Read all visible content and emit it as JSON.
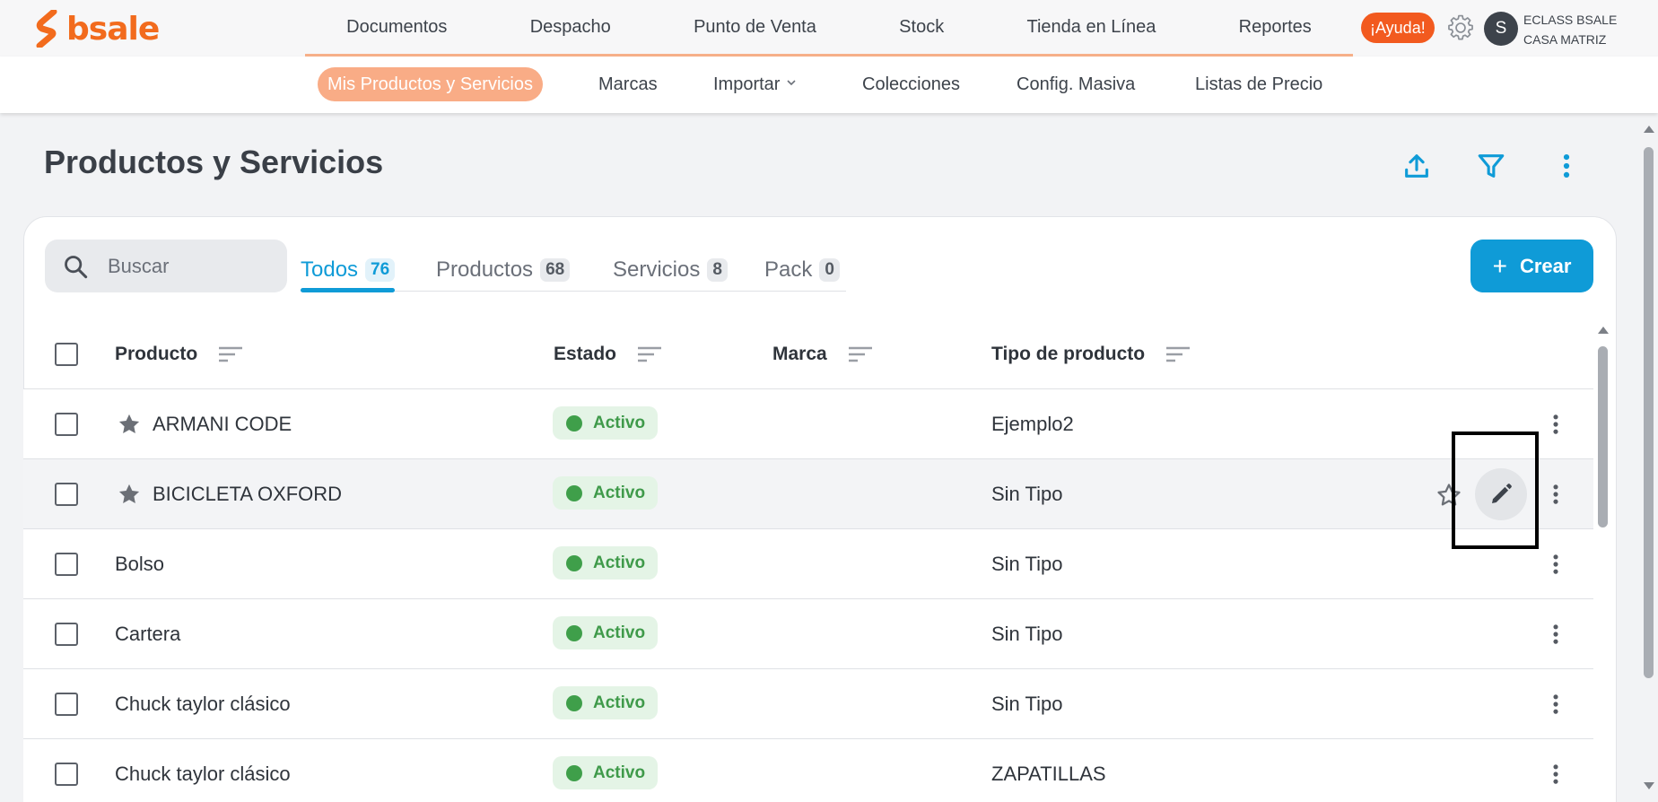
{
  "brand": {
    "name": "bsale",
    "color": "#f26b1d"
  },
  "main_nav": {
    "items": [
      {
        "label": "Documentos"
      },
      {
        "label": "Despacho"
      },
      {
        "label": "Punto de Venta"
      },
      {
        "label": "Stock"
      },
      {
        "label": "Tienda en Línea"
      },
      {
        "label": "Reportes"
      }
    ]
  },
  "header_actions": {
    "help_label": "¡Ayuda!",
    "avatar_initial": "S",
    "user_line1": "ECLASS BSALE",
    "user_line2": "CASA MATRIZ"
  },
  "sub_nav": {
    "items": [
      {
        "label": "Mis Productos y Servicios",
        "active": true
      },
      {
        "label": "Marcas"
      },
      {
        "label": "Importar",
        "has_dropdown": true
      },
      {
        "label": "Colecciones"
      },
      {
        "label": "Config. Masiva"
      },
      {
        "label": "Listas de Precio"
      }
    ]
  },
  "page": {
    "title": "Productos y Servicios",
    "icons": [
      "upload-icon",
      "filter-icon",
      "more-vertical-icon"
    ]
  },
  "search": {
    "placeholder": "Buscar",
    "value": ""
  },
  "tabs": [
    {
      "label": "Todos",
      "count": "76",
      "active": true
    },
    {
      "label": "Productos",
      "count": "68"
    },
    {
      "label": "Servicios",
      "count": "8"
    },
    {
      "label": "Pack",
      "count": "0"
    }
  ],
  "create_button": {
    "label": "Crear"
  },
  "table": {
    "columns": [
      {
        "label": "Producto"
      },
      {
        "label": "Estado"
      },
      {
        "label": "Marca"
      },
      {
        "label": "Tipo de producto"
      }
    ],
    "rows": [
      {
        "name": "ARMANI CODE",
        "starred": true,
        "status": "Activo",
        "brand": "",
        "type": "Ejemplo2"
      },
      {
        "name": "BICICLETA OXFORD",
        "starred": true,
        "status": "Activo",
        "brand": "",
        "type": "Sin Tipo",
        "hovered": true
      },
      {
        "name": "Bolso",
        "starred": false,
        "status": "Activo",
        "brand": "",
        "type": "Sin Tipo"
      },
      {
        "name": "Cartera",
        "starred": false,
        "status": "Activo",
        "brand": "",
        "type": "Sin Tipo"
      },
      {
        "name": "Chuck taylor clásico",
        "starred": false,
        "status": "Activo",
        "brand": "",
        "type": "Sin Tipo"
      },
      {
        "name": "Chuck taylor clásico",
        "starred": false,
        "status": "Activo",
        "brand": "",
        "type": "ZAPATILLAS"
      }
    ]
  },
  "colors": {
    "accent_blue": "#0f9bd7",
    "orange": "#f25a1f",
    "active_subnav": "#f9ac86",
    "status_green": "#3f9a4a"
  }
}
